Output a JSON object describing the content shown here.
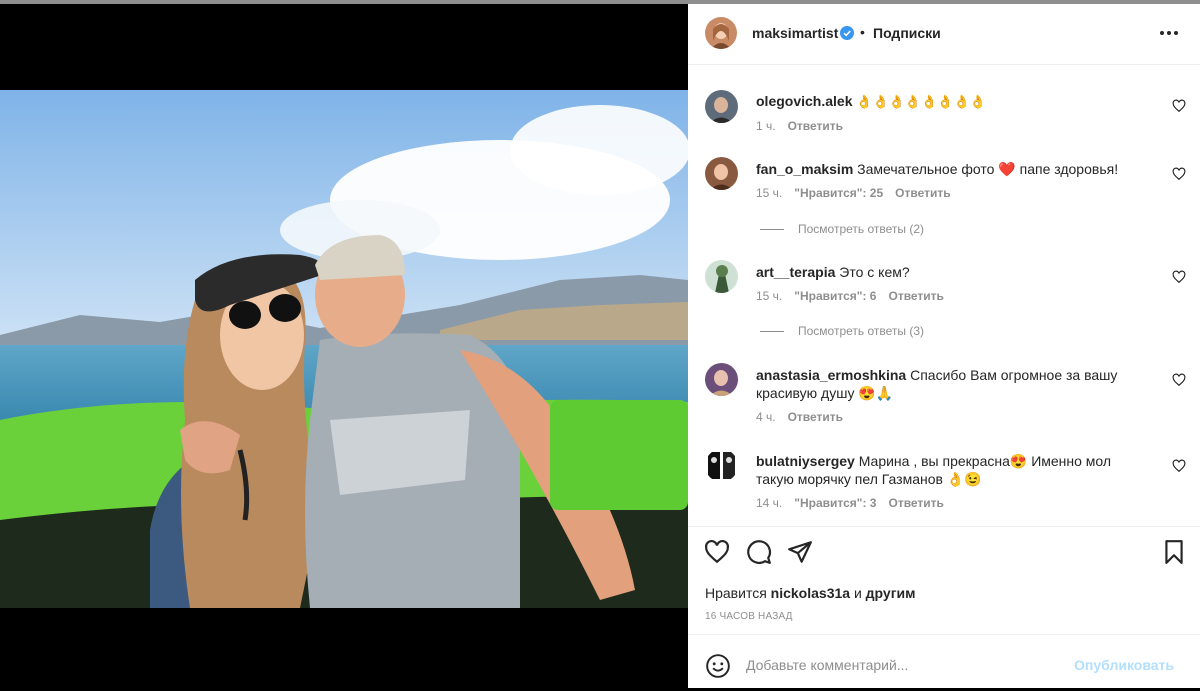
{
  "post": {
    "username": "maksimartist",
    "follow_status": "Подписки",
    "likes_prefix": "Нравится",
    "likes_user": "nickolas31a",
    "likes_and": "и",
    "likes_others": "другим",
    "time": "16 часов назад"
  },
  "comments": [
    {
      "user": "olegovich.alek",
      "text": "👌👌👌👌👌👌👌👌",
      "time": "1 ч.",
      "likes": "",
      "reply": "Ответить"
    },
    {
      "user": "fan_o_maksim",
      "text": "Замечательное фото ❤️ папе здоровья!",
      "time": "15 ч.",
      "likes": "\"Нравится\": 25",
      "reply": "Ответить",
      "view_replies": "Посмотреть ответы (2)"
    },
    {
      "user": "art__terapia",
      "text": "Это с кем?",
      "time": "15 ч.",
      "likes": "\"Нравится\": 6",
      "reply": "Ответить",
      "view_replies": "Посмотреть ответы (3)"
    },
    {
      "user": "anastasia_ermoshkina",
      "text": "Спасибо Вам огромное за вашу красивую душу 😍🙏",
      "time": "4 ч.",
      "likes": "",
      "reply": "Ответить"
    },
    {
      "user": "bulatniysergey",
      "text": "Марина , вы прекрасна😍 Именно мол такую морячку пел Газманов 👌😉",
      "time": "14 ч.",
      "likes": "\"Нравится\": 3",
      "reply": "Ответить"
    }
  ],
  "add_comment": {
    "placeholder": "Добавьте комментарий...",
    "post_label": "Опубликовать"
  },
  "colors": {
    "verified": "#3897f0",
    "heart_red": "#ed4956",
    "post_button_disabled": "#b2dffc"
  },
  "icons": [
    "heart-icon",
    "comment-icon",
    "share-icon",
    "bookmark-icon",
    "emoji-icon",
    "more-icon",
    "verified-badge-icon"
  ]
}
